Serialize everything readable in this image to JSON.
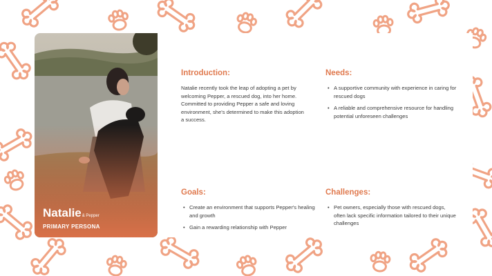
{
  "persona": {
    "name": "Natalie",
    "companion": "& Pepper",
    "role": "PRIMARY PERSONA"
  },
  "sections": {
    "introduction": {
      "title": "Introduction:",
      "text": "Natalie recently took the leap of adopting a pet by welcoming Pepper, a rescued dog, into her home. Committed to providing Pepper a safe and loving environment, she's determined to make this adoption a success."
    },
    "needs": {
      "title": "Needs:",
      "items": [
        "A supportive community with experience in caring for rescued dogs",
        "A reliable and comprehensive resource for handling potential unforeseen challenges"
      ]
    },
    "goals": {
      "title": "Goals:",
      "items": [
        "Create an environment that supports Pepper's healing and growth",
        "Gain a rewarding relationship with Pepper"
      ]
    },
    "challenges": {
      "title": "Challenges:",
      "items": [
        "Pet owners, especially those with rescued dogs, often lack specific information tailored to their unique challenges"
      ]
    }
  },
  "colors": {
    "accent": "#e07a4f",
    "pattern": "#f0a384",
    "body_text": "#3a3a3a"
  },
  "icons": [
    "bone-icon",
    "paw-print-icon"
  ]
}
